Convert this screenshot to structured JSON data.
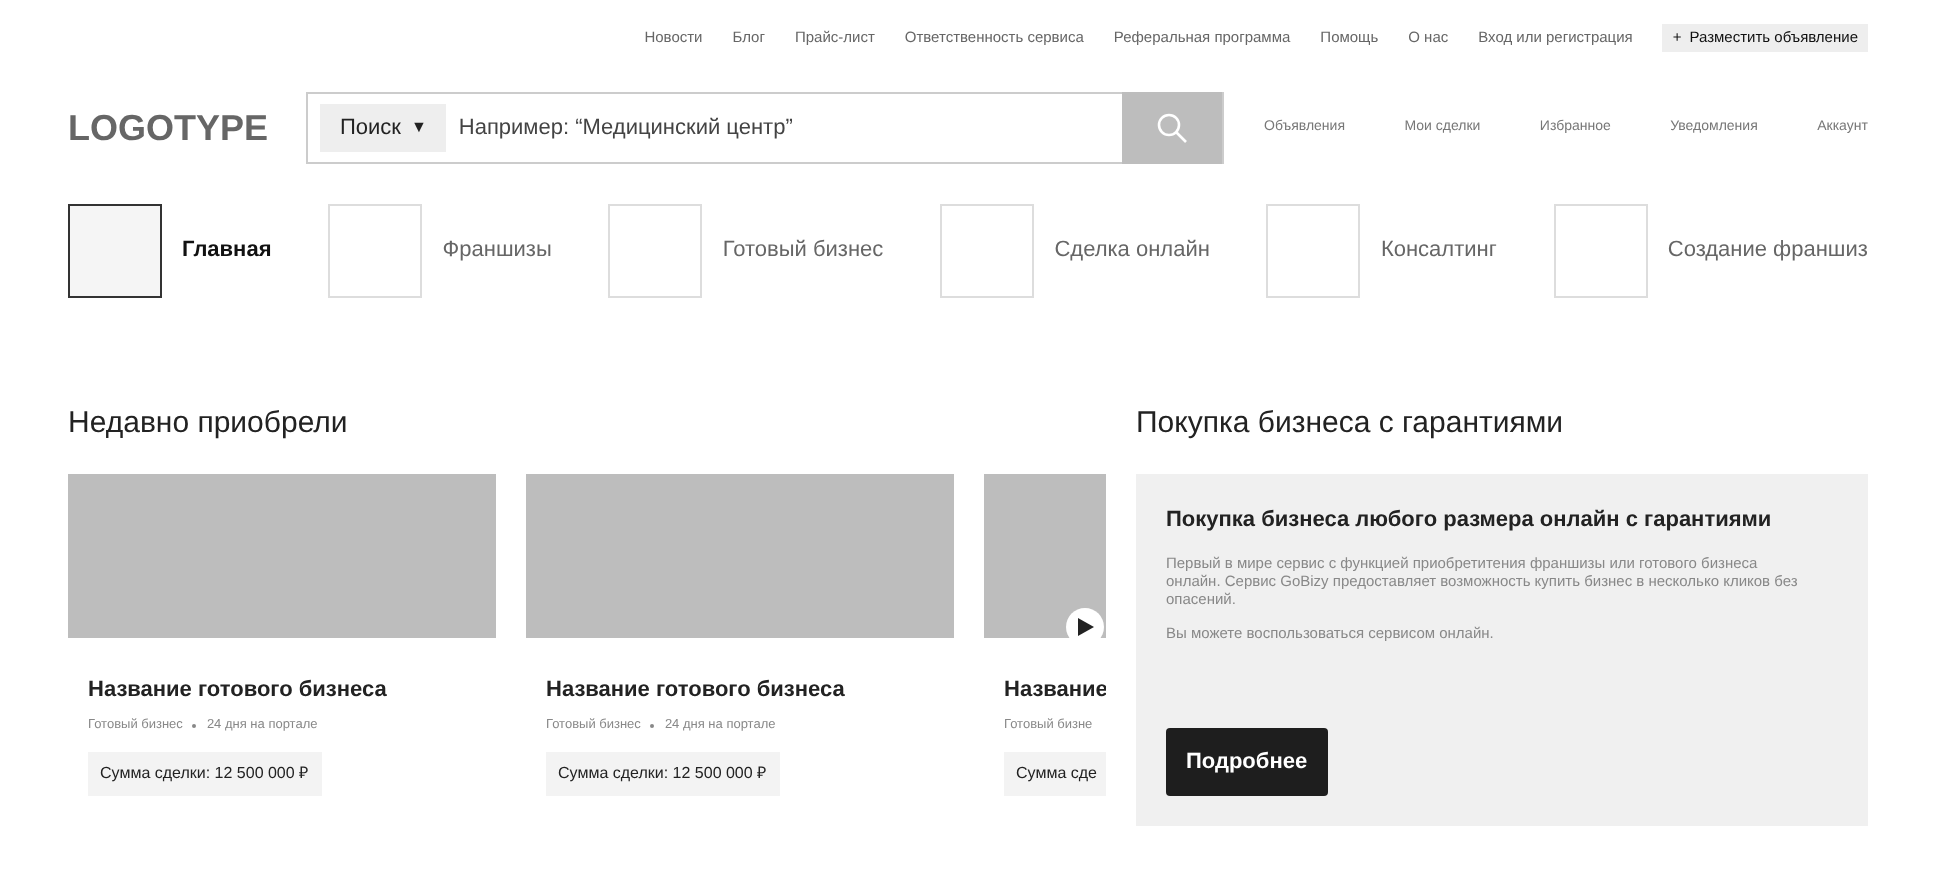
{
  "top_links": [
    "Новости",
    "Блог",
    "Прайс-лист",
    "Ответственность сервиса",
    "Реферальная программа",
    "Помощь",
    "О нас",
    "Вход или регистрация"
  ],
  "post_button": {
    "icon": "+",
    "label": "Разместить объявление"
  },
  "logo": "LOGOTYPE",
  "search": {
    "category": "Поиск",
    "caret": "▼",
    "placeholder": "Например: “Медицинский центр”"
  },
  "header_links": [
    "Объявления",
    "Мои сделки",
    "Избранное",
    "Уведомления",
    "Аккаунт"
  ],
  "categories": [
    {
      "label": "Главная",
      "selected": true
    },
    {
      "label": "Франшизы",
      "selected": false
    },
    {
      "label": "Готовый бизнес",
      "selected": false
    },
    {
      "label": "Сделка онлайн",
      "selected": false
    },
    {
      "label": "Консалтинг",
      "selected": false
    },
    {
      "label": "Создание франшиз",
      "selected": false
    }
  ],
  "recent": {
    "title": "Недавно приобрели",
    "cards": [
      {
        "name": "Название готового бизнеса",
        "category": "Готовый бизнес",
        "age": "24 дня на портале",
        "price": "Сумма сделки: 12 500 000 ₽",
        "video": false
      },
      {
        "name": "Название готового бизнеса",
        "category": "Готовый бизнес",
        "age": "24 дня на портале",
        "price": "Сумма сделки: 12 500 000 ₽",
        "video": false
      },
      {
        "name": "Название",
        "category": "Готовый бизне",
        "price": "Сумма сде",
        "video": true
      }
    ]
  },
  "guarantee": {
    "title": "Покупка бизнеса с гарантиями",
    "card_title": "Покупка бизнеса любого размера онлайн с гарантиями",
    "paragraphs": [
      "Первый в мире сервис с функцией приобретитения франшизы или готового бизнеса онлайн. Сервис GoBizy предоставляет возможность купить бизнес в несколько кликов без опасений.",
      "Вы можете воспользоваться сервисом онлайн."
    ],
    "button": "Подробнее"
  }
}
